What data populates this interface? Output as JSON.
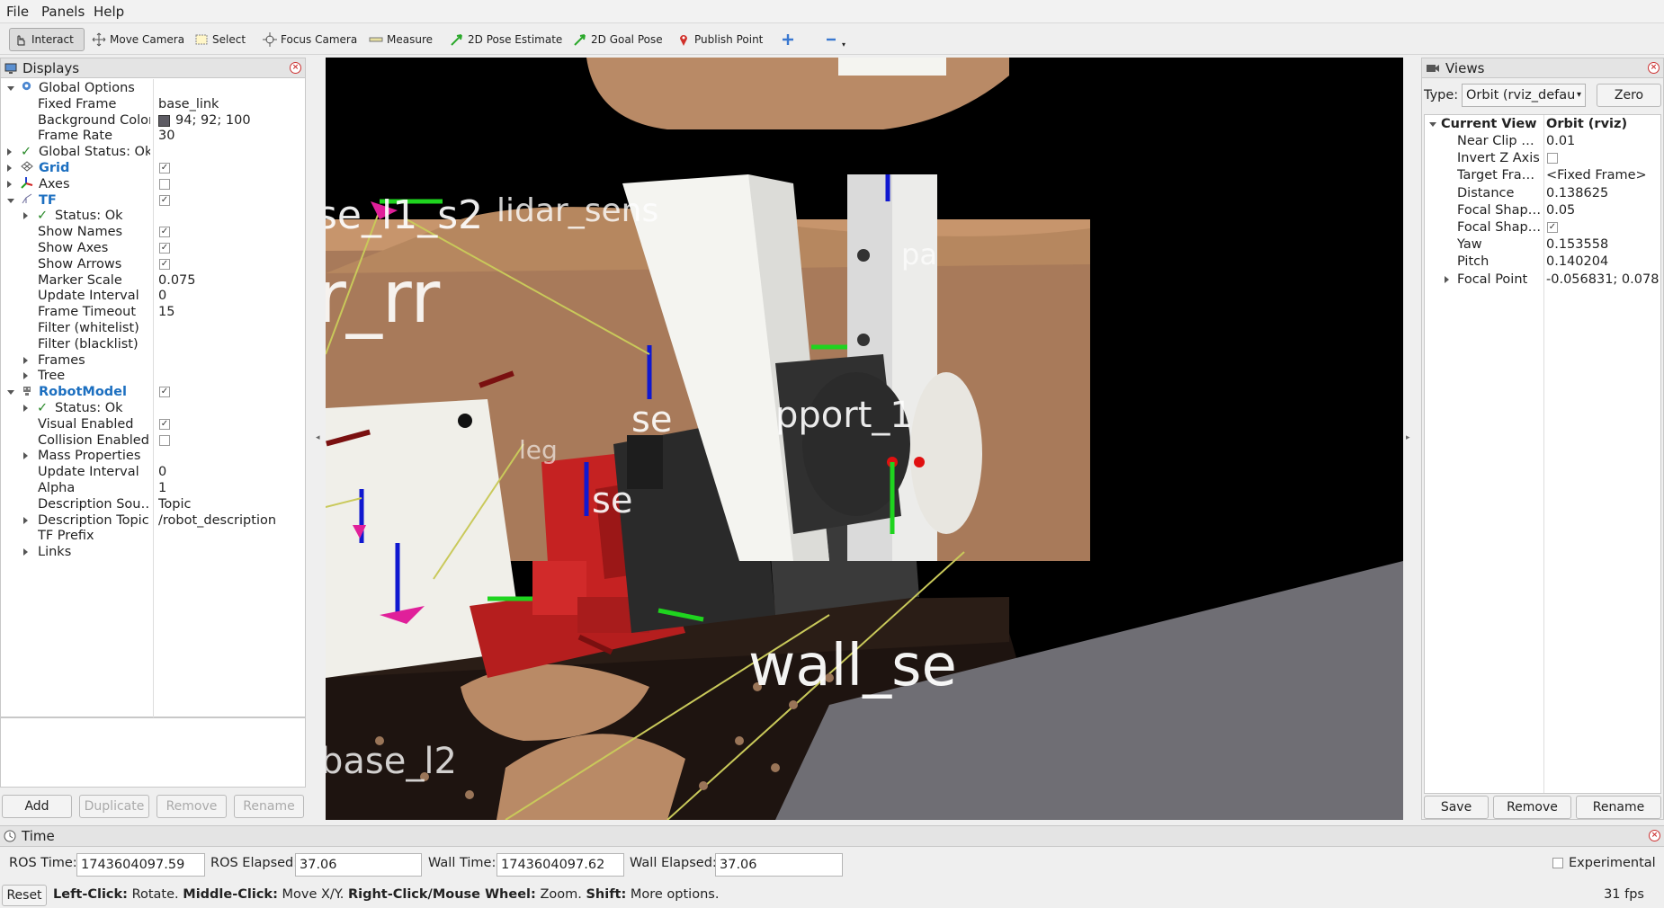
{
  "menu": {
    "file": "File",
    "panels": "Panels",
    "help": "Help"
  },
  "toolbar": {
    "interact": "Interact",
    "move_camera": "Move Camera",
    "select": "Select",
    "focus_camera": "Focus Camera",
    "measure": "Measure",
    "pose_estimate": "2D Pose Estimate",
    "goal_pose": "2D Goal Pose",
    "publish_point": "Publish Point"
  },
  "displays": {
    "title": "Displays",
    "rows": [
      {
        "label": "Global Options",
        "value": ""
      },
      {
        "label": "Fixed Frame",
        "value": "base_link"
      },
      {
        "label": "Background Color",
        "value": "94; 92; 100"
      },
      {
        "label": "Frame Rate",
        "value": "30"
      },
      {
        "label": "Global Status: Ok",
        "value": ""
      },
      {
        "label": "Grid",
        "value": ""
      },
      {
        "label": "Axes",
        "value": ""
      },
      {
        "label": "TF",
        "value": ""
      },
      {
        "label": "Status: Ok",
        "value": ""
      },
      {
        "label": "Show Names",
        "value": ""
      },
      {
        "label": "Show Axes",
        "value": ""
      },
      {
        "label": "Show Arrows",
        "value": ""
      },
      {
        "label": "Marker Scale",
        "value": "0.075"
      },
      {
        "label": "Update Interval",
        "value": "0"
      },
      {
        "label": "Frame Timeout",
        "value": "15"
      },
      {
        "label": "Filter (whitelist)",
        "value": ""
      },
      {
        "label": "Filter (blacklist)",
        "value": ""
      },
      {
        "label": "Frames",
        "value": ""
      },
      {
        "label": "Tree",
        "value": ""
      },
      {
        "label": "RobotModel",
        "value": ""
      },
      {
        "label": "Status: Ok",
        "value": ""
      },
      {
        "label": "Visual Enabled",
        "value": ""
      },
      {
        "label": "Collision Enabled",
        "value": ""
      },
      {
        "label": "Mass Properties",
        "value": ""
      },
      {
        "label": "Update Interval",
        "value": "0"
      },
      {
        "label": "Alpha",
        "value": "1"
      },
      {
        "label": "Description Sou…",
        "value": "Topic"
      },
      {
        "label": "Description Topic",
        "value": "/robot_description"
      },
      {
        "label": "TF Prefix",
        "value": ""
      },
      {
        "label": "Links",
        "value": ""
      }
    ],
    "background_color_hex": "#5e5c64",
    "buttons": {
      "add": "Add",
      "duplicate": "Duplicate",
      "remove": "Remove",
      "rename": "Rename"
    }
  },
  "views": {
    "title": "Views",
    "type_label": "Type:",
    "type_value": "Orbit (rviz_defau",
    "zero": "Zero",
    "current_view": "Current View",
    "current_view_value": "Orbit (rviz)",
    "rows": [
      {
        "label": "Near Clip …",
        "value": "0.01"
      },
      {
        "label": "Invert Z Axis",
        "value": ""
      },
      {
        "label": "Target Fra…",
        "value": "<Fixed Frame>"
      },
      {
        "label": "Distance",
        "value": "0.138625"
      },
      {
        "label": "Focal Shap…",
        "value": "0.05"
      },
      {
        "label": "Focal Shap…",
        "value": ""
      },
      {
        "label": "Yaw",
        "value": "0.153558"
      },
      {
        "label": "Pitch",
        "value": "0.140204"
      },
      {
        "label": "Focal Point",
        "value": "-0.056831; 0.078…"
      }
    ],
    "buttons": {
      "save": "Save",
      "remove": "Remove",
      "rename": "Rename"
    }
  },
  "scene_labels": {
    "l1": "se_l1_s2",
    "l2": "lidar_sens",
    "l3": "r_rr",
    "l4": "se",
    "l5": "pport_1",
    "l6": "se",
    "l7": "wall_se",
    "l8": "base_l2",
    "l9": "pa",
    "l10": "leg"
  },
  "time": {
    "title": "Time",
    "ros_time_label": "ROS Time:",
    "ros_time": "1743604097.59",
    "ros_elapsed_label": "ROS Elapsed:",
    "ros_elapsed": "37.06",
    "wall_time_label": "Wall Time:",
    "wall_time": "1743604097.62",
    "wall_elapsed_label": "Wall Elapsed:",
    "wall_elapsed": "37.06",
    "experimental": "Experimental"
  },
  "status": {
    "reset": "Reset",
    "b1": "Left-Click:",
    "t1": "Rotate.",
    "b2": "Middle-Click:",
    "t2": "Move X/Y.",
    "b3": "Right-Click/Mouse Wheel:",
    "t3": "Zoom.",
    "b4": "Shift:",
    "t4": "More options.",
    "fps": "31 fps"
  }
}
